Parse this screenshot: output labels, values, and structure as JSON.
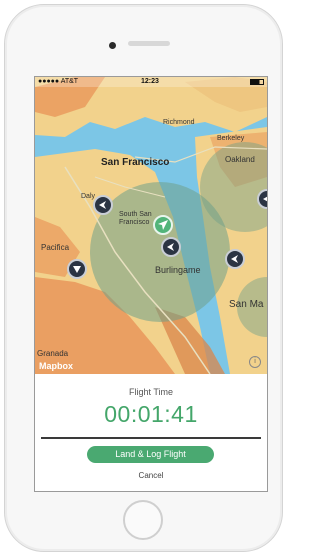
{
  "status_bar": {
    "carrier": "●●●●● AT&T",
    "time": "12:23"
  },
  "map": {
    "labels": {
      "sf": "San Francisco",
      "richmond": "Richmond",
      "berkeley": "Berkeley",
      "oakland": "Oakland",
      "daly": "Daly",
      "south_sf": "South San Francisco",
      "pacifica": "Pacifica",
      "burlingame": "Burlingame",
      "san_mateo": "San Ma",
      "granada": "Granada",
      "mapbox": "Mapbox"
    },
    "colors": {
      "water": "#7cc6e6",
      "land": "#f2d28c",
      "restricted_orange": "#e9975a",
      "flight_zone": "#6fa08a",
      "marker": "#2b3443",
      "drone": "#52b47a"
    }
  },
  "panel": {
    "flight_time_label": "Flight Time",
    "flight_time": "00:01:41",
    "land_button": "Land & Log Flight",
    "cancel": "Cancel"
  }
}
